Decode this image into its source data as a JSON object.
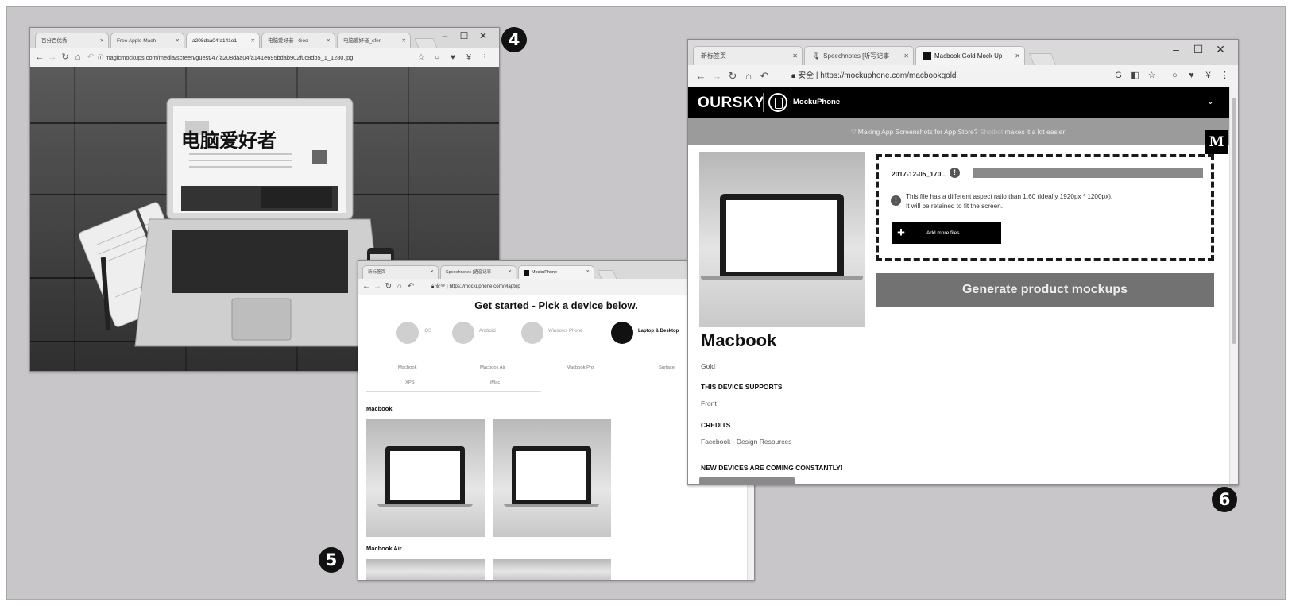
{
  "badges": {
    "win4": "4",
    "win5": "5",
    "win6": "6"
  },
  "window4": {
    "tabs": [
      {
        "label": "百分百优秀"
      },
      {
        "label": "Free Apple Mach"
      },
      {
        "label": "a208daa04fa141e1"
      },
      {
        "label": "电脑爱好者 - Goo"
      },
      {
        "label": "电脑爱好者_sfer"
      }
    ],
    "url": "magicmockups.com/media/screen/guest/47/a208daa04fa141e695bdab902f0c8db5_1_1280.jpg",
    "photo_text": "电脑爱好者"
  },
  "window5": {
    "tabs": [
      {
        "label": "新标签页"
      },
      {
        "label": "Speechnotes [语音记事"
      },
      {
        "label": "MockuPhone"
      }
    ],
    "url_prefix": "安全",
    "url": "https://mockuphone.com/#laptop",
    "heading": "Get started - Pick a device below.",
    "platforms": [
      {
        "label": "iOS"
      },
      {
        "label": "Android"
      },
      {
        "label": "Windows Phone"
      },
      {
        "label": "Laptop & Desktop"
      }
    ],
    "model_tabs": [
      "Macbook",
      "Macbook Air",
      "Macbook Pro",
      "Surface",
      "XPS",
      "iMac"
    ],
    "sections": [
      "Macbook",
      "Macbook Air"
    ]
  },
  "window6": {
    "tabs": [
      {
        "label": "新标签页"
      },
      {
        "label": "Speechnotes [听写记事"
      },
      {
        "label": "Macbook Gold Mock Up"
      }
    ],
    "url_prefix": "安全",
    "url": "https://mockuphone.com/macbookgold",
    "brand": "OURSKY",
    "product": "MockuPhone",
    "promo_a": "Making App Screenshots for App Store?",
    "promo_b": "Shotbot",
    "promo_c": "makes it a lot easier!",
    "m_badge": "M",
    "file_name": "2017-12-05_170...",
    "error_line1": "This file has a different aspect ratio than 1.60 (ideally 1920px * 1200px).",
    "error_line2": "It will be retained to fit the screen.",
    "add_more": "Add more files",
    "generate": "Generate product mockups",
    "device_name": "Macbook",
    "device_color": "Gold",
    "supports_heading": "THIS DEVICE SUPPORTS",
    "supports_value": "Front",
    "credits_heading": "CREDITS",
    "credits_value": "Facebook - Design Resources",
    "new_devices": "NEW DEVICES ARE COMING CONSTANTLY!"
  }
}
